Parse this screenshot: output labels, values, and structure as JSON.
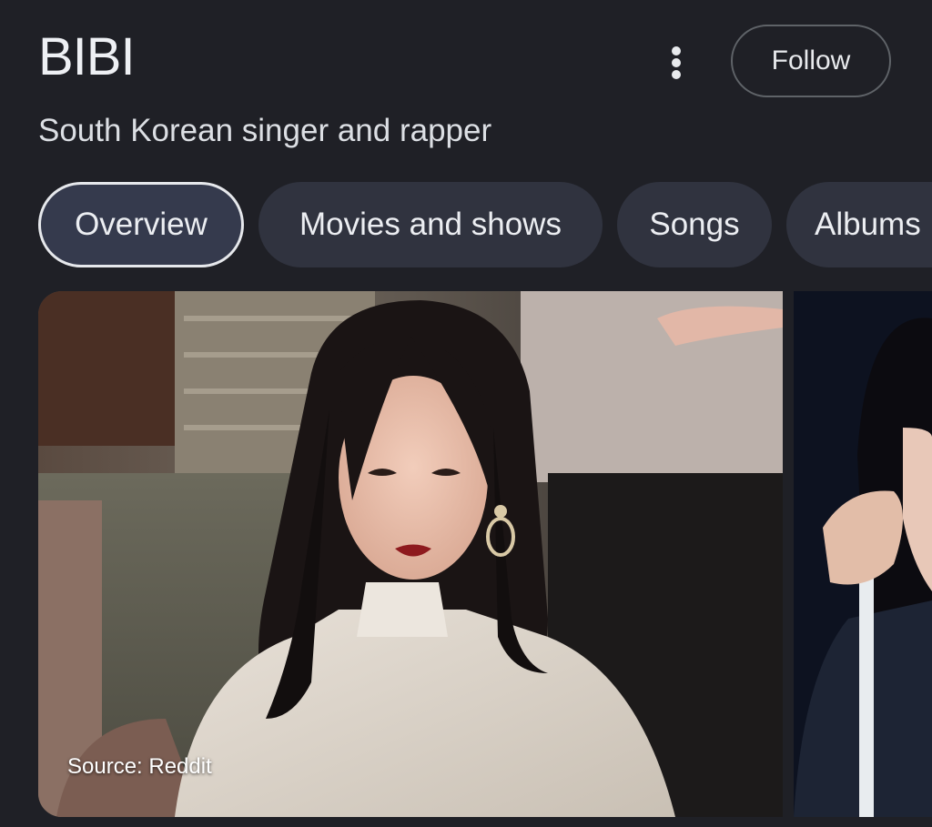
{
  "header": {
    "title": "BIBI",
    "subtitle": "South Korean singer and rapper",
    "follow_label": "Follow",
    "more_icon": "more-vert-icon"
  },
  "tabs": [
    {
      "label": "Overview",
      "active": true
    },
    {
      "label": "Movies and shows",
      "active": false
    },
    {
      "label": "Songs",
      "active": false
    },
    {
      "label": "Albums",
      "active": false
    }
  ],
  "images": {
    "main_source": "Source: Reddit"
  },
  "colors": {
    "background": "#1f2026",
    "tab_bg": "#30333f",
    "tab_active_bg": "#353a4d",
    "text": "#e8eaed",
    "lipstick": "#8e1a1e"
  }
}
